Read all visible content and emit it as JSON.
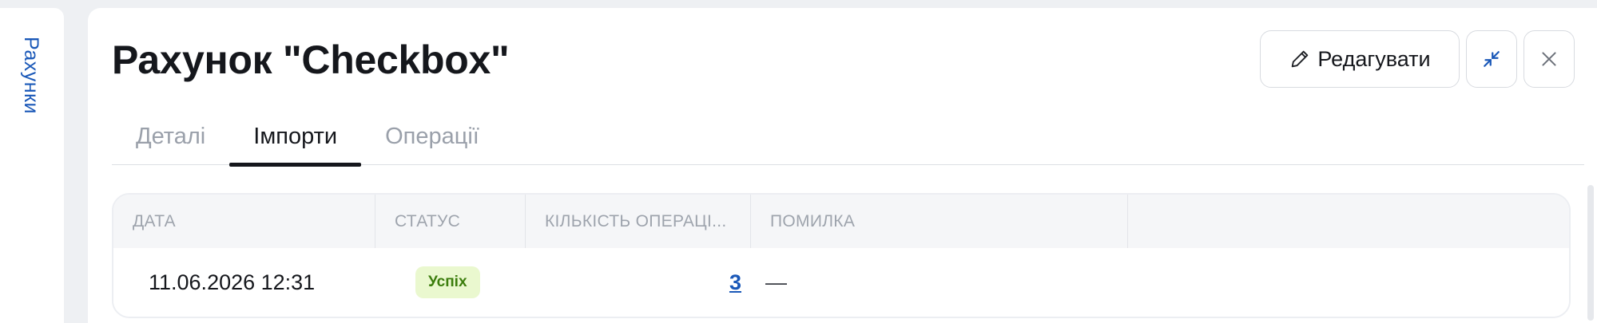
{
  "sidebar": {
    "label": "Рахунки"
  },
  "header": {
    "title": "Рахунок \"Checkbox\"",
    "edit_label": "Редагувати",
    "icons": {
      "edit": "pencil-icon",
      "collapse": "collapse-icon",
      "close": "close-icon"
    }
  },
  "tabs": [
    {
      "label": "Деталі",
      "active": false
    },
    {
      "label": "Імпорти",
      "active": true
    },
    {
      "label": "Операції",
      "active": false
    }
  ],
  "table": {
    "columns": [
      "ДАТА",
      "СТАТУС",
      "КІЛЬКІСТЬ ОПЕРАЦІ...",
      "ПОМИЛКА",
      ""
    ],
    "rows": [
      {
        "date": "11.06.2026 12:31",
        "status": "Успіх",
        "count": "3",
        "error": "—"
      }
    ]
  },
  "colors": {
    "accent": "#1a58b8",
    "success_bg": "#eaf8cf",
    "success_text": "#3b7d0c"
  }
}
